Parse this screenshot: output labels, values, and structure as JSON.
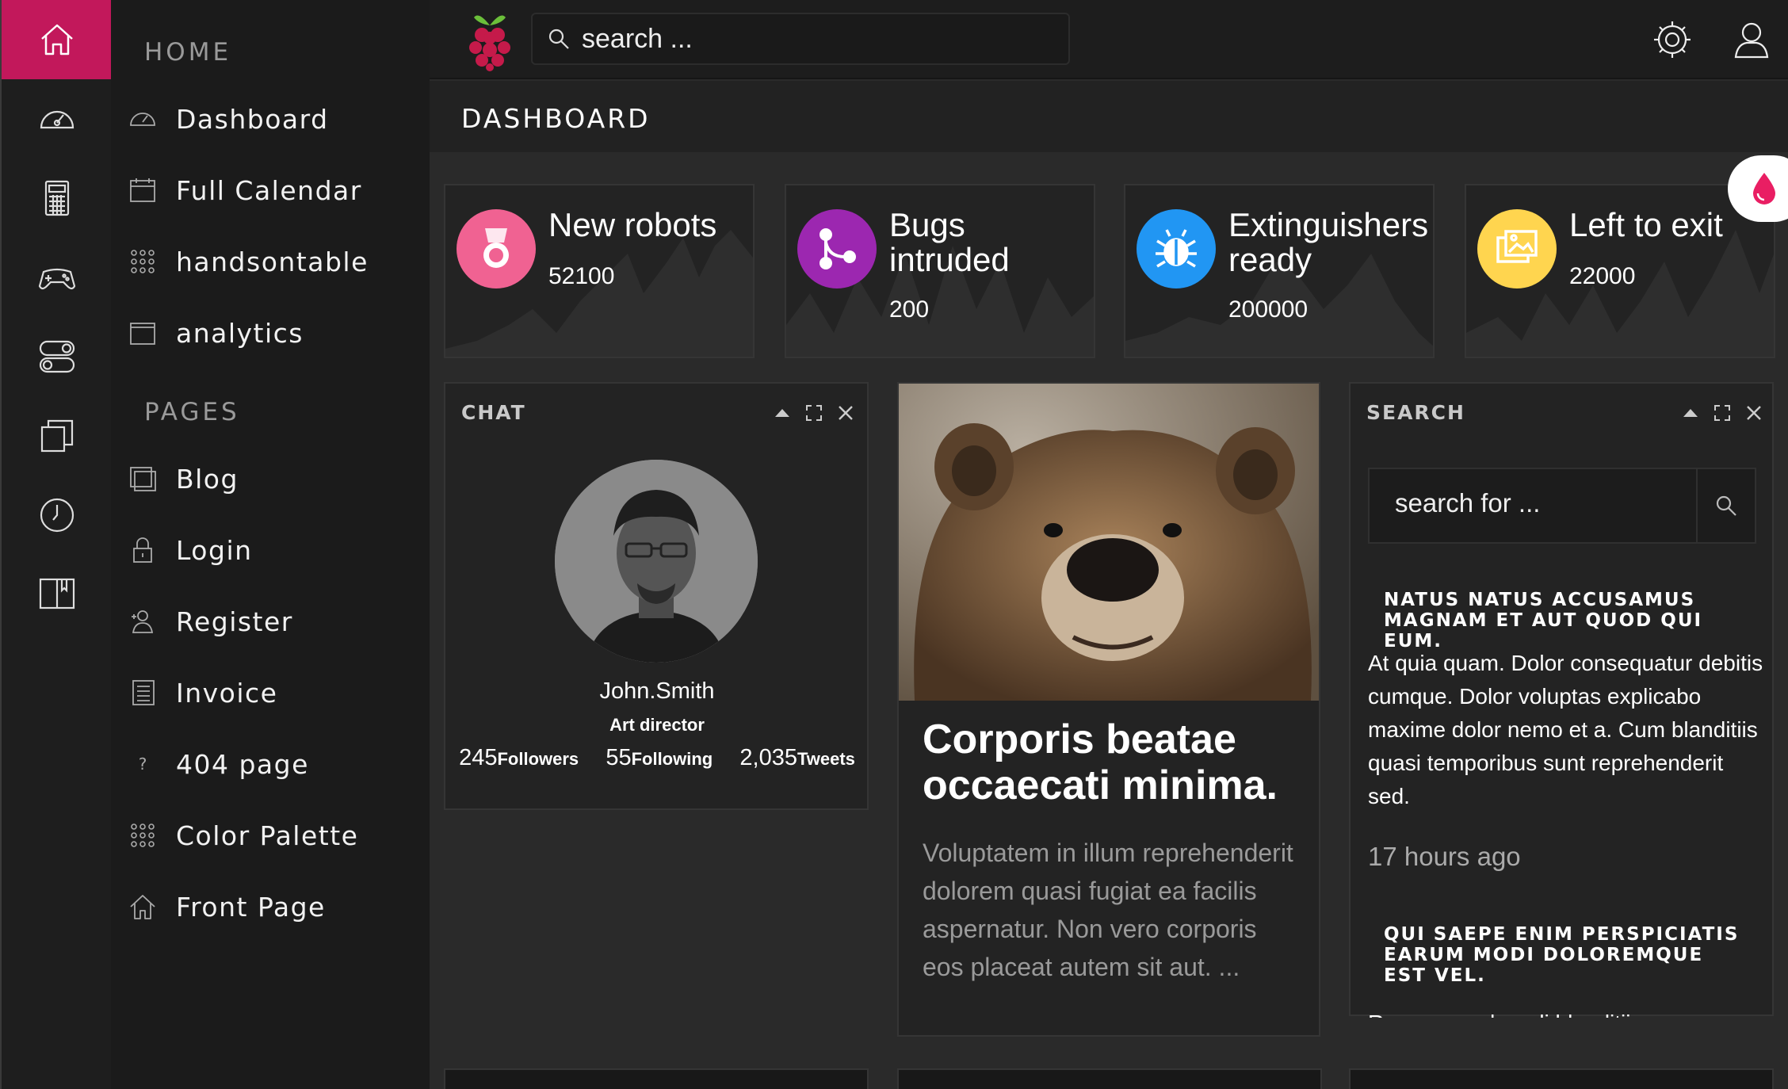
{
  "sidebar": {
    "rail_icons": [
      "home-icon",
      "speedometer-icon",
      "calculator-icon",
      "gamepad-icon",
      "toggle-icon",
      "copy-icon",
      "clock-icon",
      "book-icon"
    ],
    "sections": [
      {
        "heading": "HOME",
        "items": [
          {
            "label": "Dashboard",
            "icon": "speedometer-icon"
          },
          {
            "label": "Full Calendar",
            "icon": "calendar-icon"
          },
          {
            "label": "handsontable",
            "icon": "grid-icon"
          },
          {
            "label": "analytics",
            "icon": "window-icon"
          }
        ]
      },
      {
        "heading": "PAGES",
        "items": [
          {
            "label": "Blog",
            "icon": "browser-icon"
          },
          {
            "label": "Login",
            "icon": "lock-icon"
          },
          {
            "label": "Register",
            "icon": "user-add-icon"
          },
          {
            "label": "Invoice",
            "icon": "document-icon"
          },
          {
            "label": "404 page",
            "icon": "question-icon"
          },
          {
            "label": "Color Palette",
            "icon": "grid-icon"
          },
          {
            "label": "Front Page",
            "icon": "house-icon"
          }
        ]
      }
    ]
  },
  "topbar": {
    "search_placeholder": "search ...",
    "icons": [
      "raspberry-logo-icon",
      "search-icon",
      "gear-icon",
      "user-icon"
    ]
  },
  "page_title": "DASHBOARD",
  "stats": [
    {
      "title": "New robots",
      "value": "52100",
      "color": "#f06292",
      "icon": "medal-icon"
    },
    {
      "title": "Bugs intruded",
      "value": "200",
      "color": "#9c27b0",
      "icon": "branch-icon"
    },
    {
      "title": "Extinguishers ready",
      "value": "200000",
      "color": "#2196f3",
      "icon": "bug-icon"
    },
    {
      "title": "Left to exit",
      "value": "22000",
      "color": "#ffd54f",
      "icon": "images-icon"
    }
  ],
  "chat": {
    "heading": "CHAT",
    "name": "John.Smith",
    "role": "Art director",
    "counts": [
      {
        "n": "245",
        "unit": "Followers"
      },
      {
        "n": "55",
        "unit": "Following"
      },
      {
        "n": "2,035",
        "unit": "Tweets"
      }
    ]
  },
  "post": {
    "title": "Corporis beatae occaecati minima.",
    "body": "Voluptatem in illum reprehenderit dolorem quasi fugiat ea facilis aspernatur. Non vero corporis eos placeat autem sit aut. ..."
  },
  "search_panel": {
    "heading": "SEARCH",
    "placeholder": "search for ...",
    "results": [
      {
        "title": "NATUS NATUS ACCUSAMUS MAGNAM ET AUT QUOD QUI EUM.",
        "body": "At quia quam. Dolor consequatur debitis cumque. Dolor voluptas explicabo maxime dolor nemo et a. Cum blanditiis quasi temporibus sunt reprehenderit sed.",
        "time": "17 hours ago"
      },
      {
        "title": "QUI SAEPE ENIM PERSPICIATIS EARUM MODI DOLOREMQUE EST VEL.",
        "body": "Rem eum ad modi blanditiis eaque"
      }
    ]
  },
  "colors": {
    "accent": "#c2185b",
    "rail_bg": "#1e1e1e",
    "nav_bg": "#1b1b1b",
    "page_bg": "#2a2a2a",
    "card_bg": "#232323"
  }
}
